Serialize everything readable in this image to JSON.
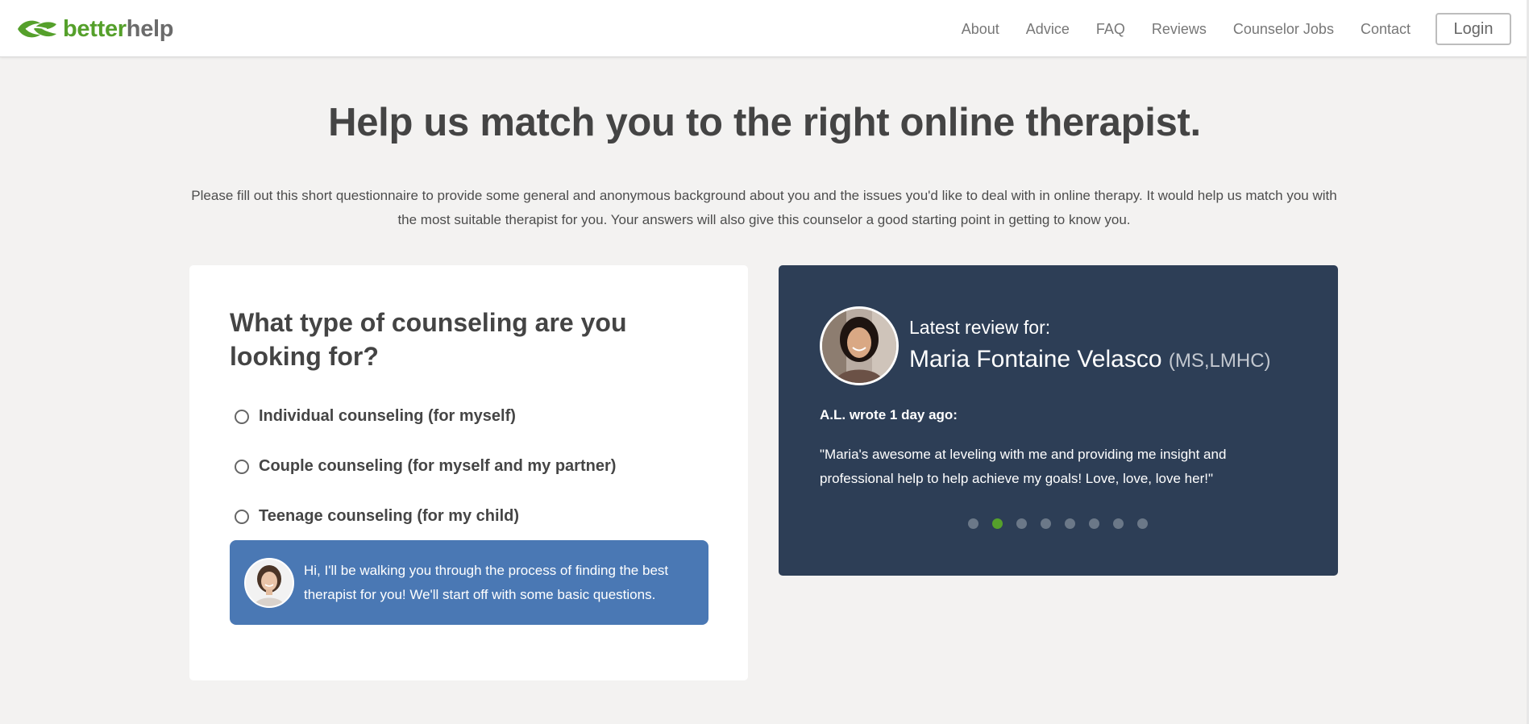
{
  "header": {
    "logo": {
      "part1": "better",
      "part2": "help",
      "icon": "leaf-logo-icon"
    },
    "nav": [
      {
        "label": "About"
      },
      {
        "label": "Advice"
      },
      {
        "label": "FAQ"
      },
      {
        "label": "Reviews"
      },
      {
        "label": "Counselor Jobs"
      },
      {
        "label": "Contact"
      }
    ],
    "login_label": "Login"
  },
  "main": {
    "headline": "Help us match you to the right online therapist.",
    "intro": "Please fill out this short questionnaire to provide some general and anonymous background about you and the issues you'd like to deal with in online therapy. It would help us match you with the most suitable therapist for you. Your answers will also give this counselor a good starting point in getting to know you."
  },
  "question": {
    "title": "What type of counseling are you looking for?",
    "options": [
      {
        "label": "Individual counseling (for myself)"
      },
      {
        "label": "Couple counseling (for myself and my partner)"
      },
      {
        "label": "Teenage counseling (for my child)"
      }
    ],
    "assistant_message": "Hi, I'll be walking you through the process of finding the best therapist for you! We'll start off with some basic questions."
  },
  "review": {
    "latest_label": "Latest review for:",
    "therapist_name": "Maria Fontaine Velasco",
    "credentials": "(MS,LMHC)",
    "author": "A.L. wrote 1 day ago:",
    "quote": "\"Maria's awesome at leveling with me and providing me insight and professional help to help achieve my goals! Love, love, love her!\"",
    "slide_count": 8,
    "active_slide": 2
  },
  "colors": {
    "brand_green": "#55a02b",
    "brand_gray": "#6b6b6b",
    "page_bg": "#f3f2f1",
    "review_bg": "#2d3e56",
    "assistant_bubble": "#4a78b4"
  }
}
